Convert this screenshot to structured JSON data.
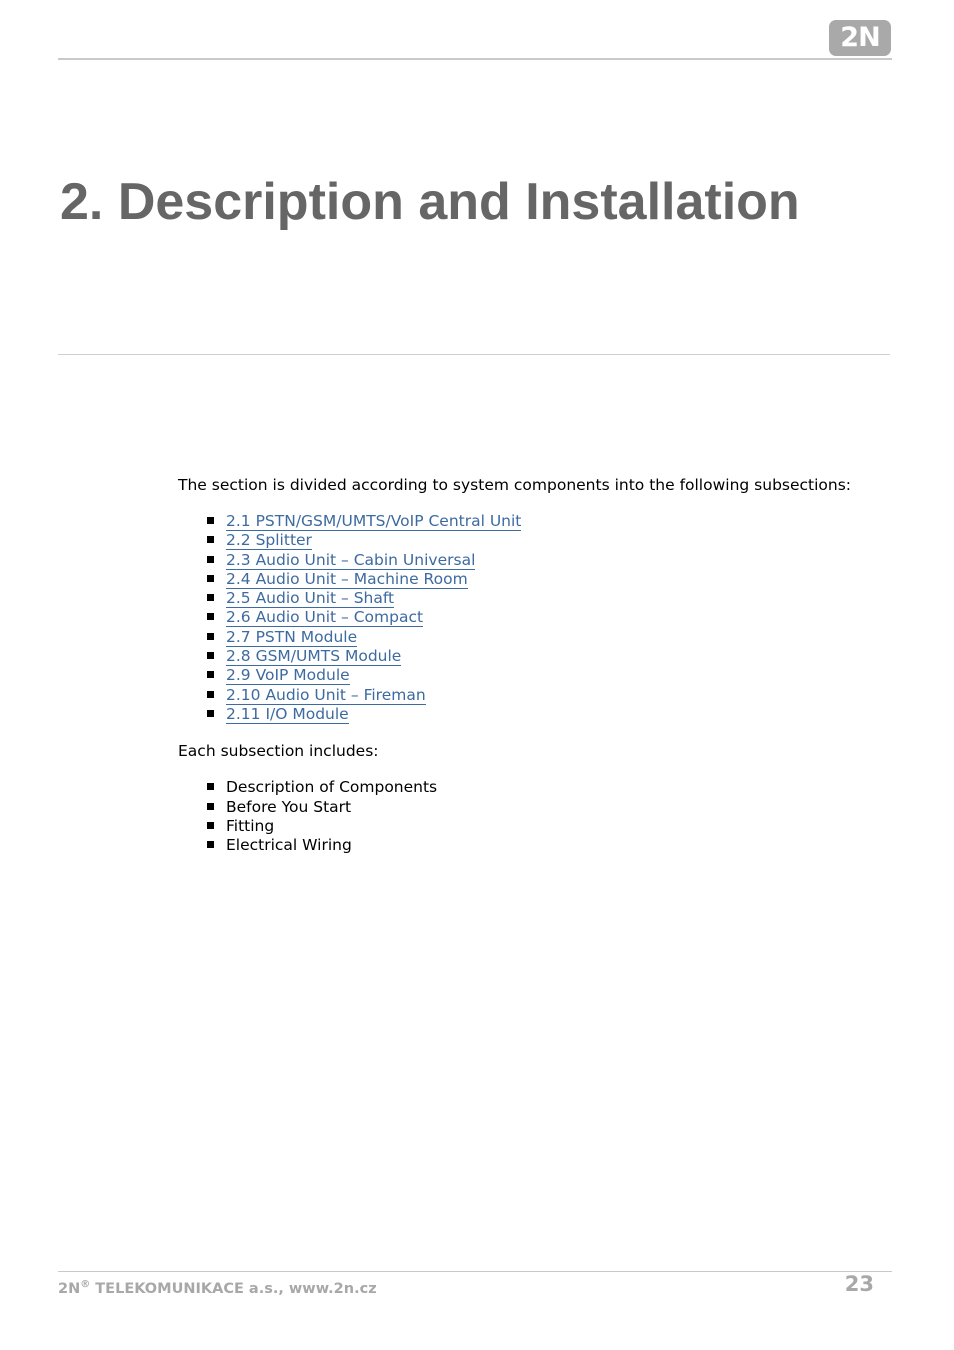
{
  "header": {
    "logo_text": "2N"
  },
  "title": "2. Description and Installation",
  "intro": "The section is divided according to system components into the following subsections:",
  "subsections": [
    "2.1 PSTN/GSM/UMTS/VoIP Central Unit",
    "2.2 Splitter",
    "2.3 Audio Unit – Cabin Universal",
    "2.4 Audio Unit – Machine Room",
    "2.5 Audio Unit – Shaft",
    "2.6 Audio Unit – Compact",
    "2.7 PSTN Module",
    "2.8 GSM/UMTS Module",
    "2.9 VoIP Module",
    "2.10 Audio Unit – Fireman",
    "2.11 I/O Module"
  ],
  "includes_label": "Each subsection includes:",
  "includes": [
    "Description of Components",
    "Before You Start",
    "Fitting",
    "Electrical Wiring"
  ],
  "footer": {
    "brand": "2N",
    "registered": "®",
    "company": " TELEKOMUNIKACE a.s., www.2n.cz",
    "page_number": "23"
  },
  "colors": {
    "link": "#3d6aa0",
    "title": "#666666",
    "footer": "#a8a8a8"
  }
}
